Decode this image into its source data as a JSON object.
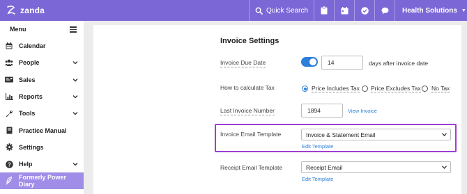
{
  "app": {
    "logo_text": "zanda",
    "search_label": "Quick Search",
    "account_name": "Health Solutions"
  },
  "colors": {
    "brand": "#7b68d6",
    "sidebar_active": "#9f8de8",
    "accent_blue": "#2b7fd8",
    "highlight": "#a03cd1"
  },
  "toolbar_icons": [
    "clipboard-icon",
    "calendar-icon",
    "check-circle-icon",
    "chat-icon"
  ],
  "sidebar": {
    "menu_label": "Menu",
    "items": [
      {
        "label": "Calendar",
        "icon": "calendar-icon",
        "has_chevron": false
      },
      {
        "label": "People",
        "icon": "people-icon",
        "has_chevron": true
      },
      {
        "label": "Sales",
        "icon": "sales-icon",
        "has_chevron": true
      },
      {
        "label": "Reports",
        "icon": "chart-icon",
        "has_chevron": true
      },
      {
        "label": "Tools",
        "icon": "wrench-icon",
        "has_chevron": true
      },
      {
        "label": "Practice Manual",
        "icon": "book-icon",
        "has_chevron": false
      },
      {
        "label": "Settings",
        "icon": "gear-icon",
        "has_chevron": false
      },
      {
        "label": "Help",
        "icon": "help-icon",
        "has_chevron": true
      },
      {
        "label": "Formerly Power Diary",
        "icon": "feather-icon",
        "has_chevron": false,
        "active": true
      }
    ]
  },
  "settings": {
    "title": "Invoice Settings",
    "due_date": {
      "label": "Invoice Due Date",
      "enabled": true,
      "value": "14",
      "suffix": "days after invoice date"
    },
    "tax": {
      "label": "How to calculate Tax",
      "options": [
        "Price Includes Tax",
        "Price Excludes Tax",
        "No Tax"
      ],
      "selected": "Price Includes Tax"
    },
    "last_invoice": {
      "label": "Last Invoice Number",
      "value": "1894",
      "link": "View Invoice"
    },
    "email_template": {
      "label": "Invoice Email Template",
      "value": "Invoice & Statement Email",
      "link": "Edit Template"
    },
    "receipt_template": {
      "label": "Receipt Email Template",
      "value": "Receipt Email",
      "link": "Edit Template"
    }
  }
}
